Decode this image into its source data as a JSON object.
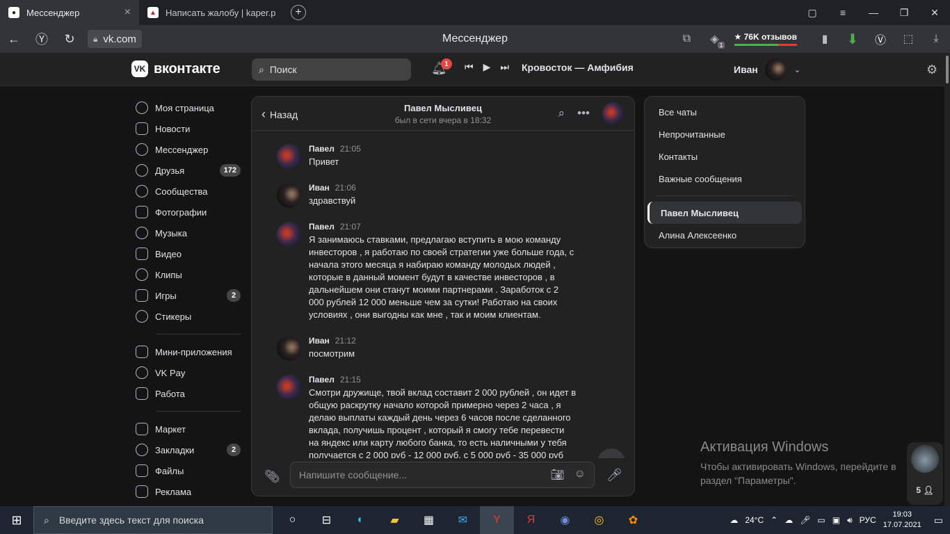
{
  "browser": {
    "tabs": [
      {
        "title": "Мессенджер",
        "active": true
      },
      {
        "title": "Написать жалобу | kaper.p",
        "active": false
      }
    ],
    "url": "vk.com",
    "page_title": "Мессенджер",
    "reviews_label": "★ 76K отзывов",
    "badge_count": "1"
  },
  "vk_header": {
    "logo_text": "вконтакте",
    "search_placeholder": "Поиск",
    "notifications_count": "1",
    "track": "Кровосток — Амфибия",
    "user_name": "Иван"
  },
  "sidebar": {
    "group1": [
      {
        "label": "Моя страница",
        "icon": "user-circle-icon"
      },
      {
        "label": "Новости",
        "icon": "news-icon"
      },
      {
        "label": "Мессенджер",
        "icon": "message-icon"
      },
      {
        "label": "Друзья",
        "icon": "friends-icon",
        "count": "172"
      },
      {
        "label": "Сообщества",
        "icon": "communities-icon"
      },
      {
        "label": "Фотографии",
        "icon": "photo-icon"
      },
      {
        "label": "Музыка",
        "icon": "music-icon"
      },
      {
        "label": "Видео",
        "icon": "video-icon"
      },
      {
        "label": "Клипы",
        "icon": "clips-icon"
      },
      {
        "label": "Игры",
        "icon": "games-icon",
        "count": "2"
      },
      {
        "label": "Стикеры",
        "icon": "sticker-icon"
      }
    ],
    "group2": [
      {
        "label": "Мини-приложения",
        "icon": "apps-icon"
      },
      {
        "label": "VK Pay",
        "icon": "vkpay-icon"
      },
      {
        "label": "Работа",
        "icon": "work-icon"
      }
    ],
    "group3": [
      {
        "label": "Маркет",
        "icon": "market-icon"
      },
      {
        "label": "Закладки",
        "icon": "bookmark-icon",
        "count": "2"
      },
      {
        "label": "Файлы",
        "icon": "files-icon"
      },
      {
        "label": "Реклама",
        "icon": "ads-icon"
      }
    ]
  },
  "chat": {
    "back_label": "Назад",
    "name": "Павел Мысливец",
    "status": "был в сети вчера в 18:32",
    "messages": [
      {
        "author": "Павел",
        "time": "21:05",
        "text": "Привет"
      },
      {
        "author": "Иван",
        "time": "21:06",
        "text": "здравствуй"
      },
      {
        "author": "Павел",
        "time": "21:07",
        "text": "Я занимаюсь ставками, предлагаю вступить в мою команду\nинвесторов , я работаю по своей стратегии уже больше года, с\nначала этого месяца я набираю команду молодых людей ,\nкоторые в данный момент будут в качестве инвесторов , в\nдальнейшем они станут моими партнерами . Заработок с 2\n000 рублей 12 000 меньше чем за сутки! Работаю на своих\nусловиях , они выгодны как мне , так и моим клиентам."
      },
      {
        "author": "Иван",
        "time": "21:12",
        "text": "посмотрим"
      },
      {
        "author": "Павел",
        "time": "21:15",
        "text": "Смотри дружище, твой вклад составит 2 000 рублей , он идет в\nобщую раскрутку начало которой примерно через 2 часа , я\nделаю выплаты каждый день через 6 часов после сделанного\nвклада, получишь процент , который я смогу тебе перевести\nна яндекс или карту любого банка, то есть наличными у тебя\nполучается с 2 000 руб - 12 000 руб, с 5 000 руб - 35 000 руб"
      }
    ],
    "input_placeholder": "Напишите сообщение..."
  },
  "folders": {
    "items": [
      "Все чаты",
      "Непрочитанные",
      "Контакты",
      "Важные сообщения"
    ],
    "chats": [
      {
        "label": "Павел Мысливец",
        "selected": true
      },
      {
        "label": "Алина Алексеенко",
        "selected": false
      }
    ]
  },
  "overlay": {
    "activation_title": "Активация Windows",
    "activation_text": "Чтобы активировать Windows, перейдите в\nраздел \"Параметры\".",
    "online_count": "5"
  },
  "taskbar": {
    "search_placeholder": "Введите здесь текст для поиска",
    "weather": "24°C",
    "lang": "РУС",
    "time": "19:03",
    "date": "17.07.2021"
  },
  "colors": {
    "background": "#141414",
    "panel": "#222222",
    "accent_badge": "#e64646",
    "text": "#e1e3e6",
    "secondary_text": "#939393"
  }
}
